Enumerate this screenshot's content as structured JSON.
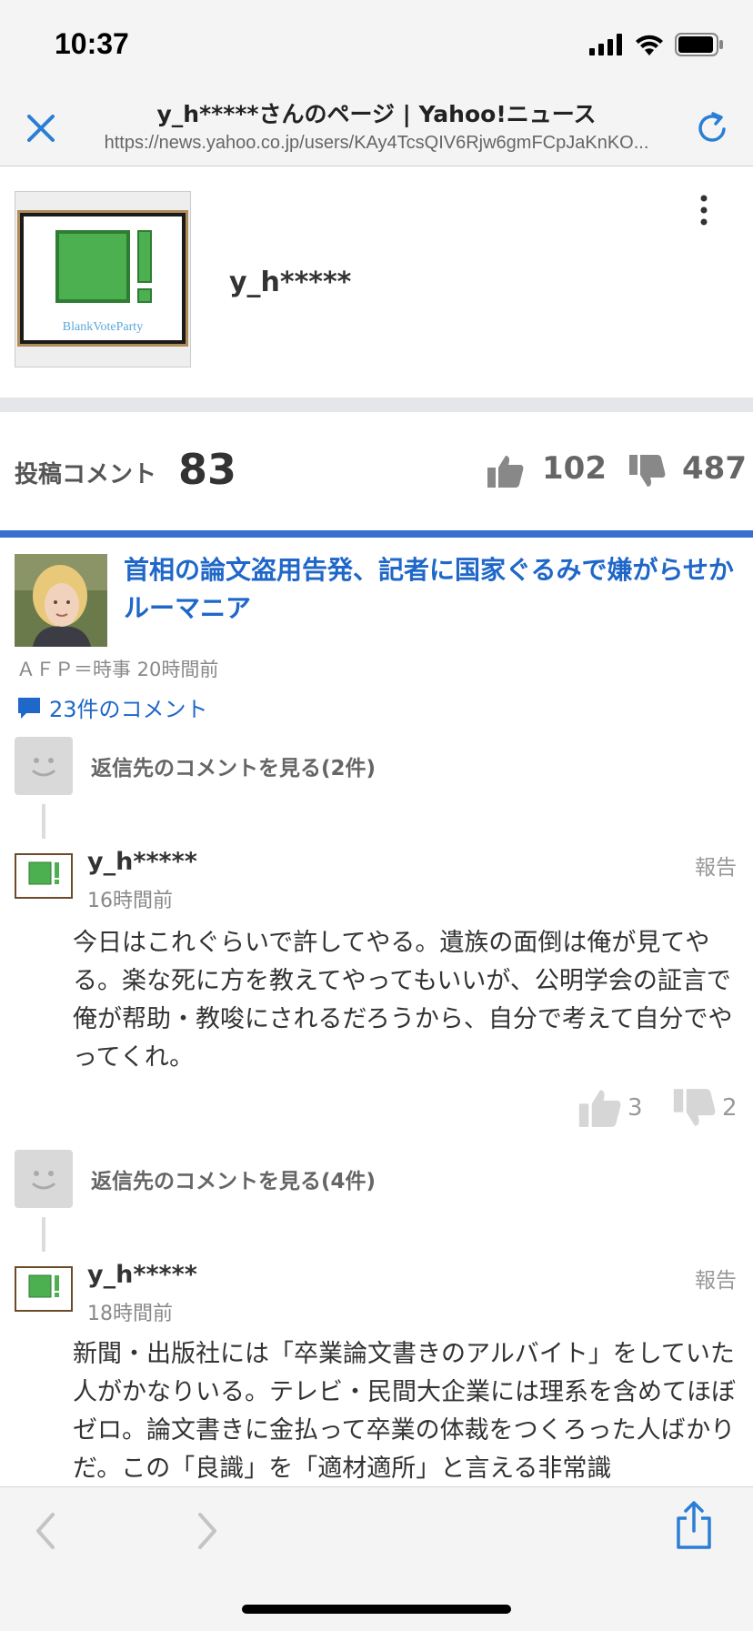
{
  "status_bar": {
    "time": "10:37"
  },
  "browser": {
    "page_title": "y_h*****さんのページ | Yahoo!ニュース",
    "url": "https://news.yahoo.co.jp/users/KAy4TcsQIV6Rjw6gmFCpJaKnKO..."
  },
  "profile": {
    "name": "y_h*****",
    "logo_text": "BlankVoteParty"
  },
  "stats": {
    "label": "投稿コメント",
    "count": "83",
    "likes": "102",
    "dislikes": "487"
  },
  "article": {
    "title": "首相の論文盗用告発、記者に国家ぐるみで嫌がらせか ルーマニア",
    "source": "ＡＦＰ＝時事 20時間前",
    "comments_link": "23件のコメント"
  },
  "threads": [
    {
      "reply_link": "返信先のコメントを見る(2件)",
      "user": "y_h*****",
      "time": "16時間前",
      "report": "報告",
      "body": "今日はこれぐらいで許してやる。遺族の面倒は俺が見てやる。楽な死に方を教えてやってもいいが、公明学会の証言で俺が帮助・教唆にされるだろうから、自分で考えて自分でやってくれ。",
      "likes": "3",
      "dislikes": "2"
    },
    {
      "reply_link": "返信先のコメントを見る(4件)",
      "user": "y_h*****",
      "time": "18時間前",
      "report": "報告",
      "body": "新聞・出版社には「卒業論文書きのアルバイト」をしていた人がかなりいる。テレビ・民間大企業には理系を含めてほぼゼロ。論文書きに金払って卒業の体裁をつくろった人ばかりだ。この「良識」を「適材適所」と言える非常識"
    }
  ],
  "colors": {
    "link_blue": "#1f67c8",
    "accent_line": "#3a6fd1",
    "ios_blue": "#2a7fd4"
  }
}
